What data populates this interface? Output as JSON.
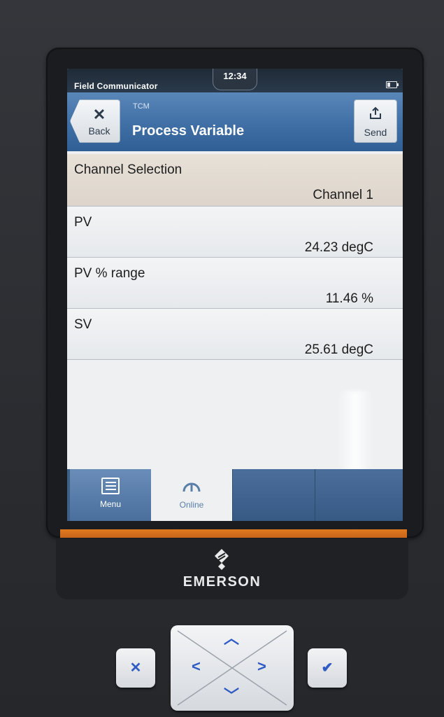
{
  "status": {
    "app_name": "Field Communicator",
    "time": "12:34"
  },
  "header": {
    "back_label": "Back",
    "back_icon": "close-x-icon",
    "subtitle": "TCM",
    "title": "Process Variable",
    "send_label": "Send",
    "send_icon": "send-upload-icon",
    "accent_color": "#3f6fa5"
  },
  "list": [
    {
      "label": "Channel Selection",
      "value": "Channel 1"
    },
    {
      "label": "PV",
      "value": "24.23 degC"
    },
    {
      "label": "PV % range",
      "value": "11.46 %"
    },
    {
      "label": "SV",
      "value": "25.61 degC"
    }
  ],
  "tabs": {
    "menu_label": "Menu",
    "online_label": "Online"
  },
  "device": {
    "brand": "EMERSON",
    "brand_accent": "#e07a1f",
    "keys": {
      "cancel_glyph": "✕",
      "enter_glyph": "✔"
    },
    "dpad": {
      "up": "︿",
      "down": "﹀",
      "left": "<",
      "right": ">"
    }
  }
}
